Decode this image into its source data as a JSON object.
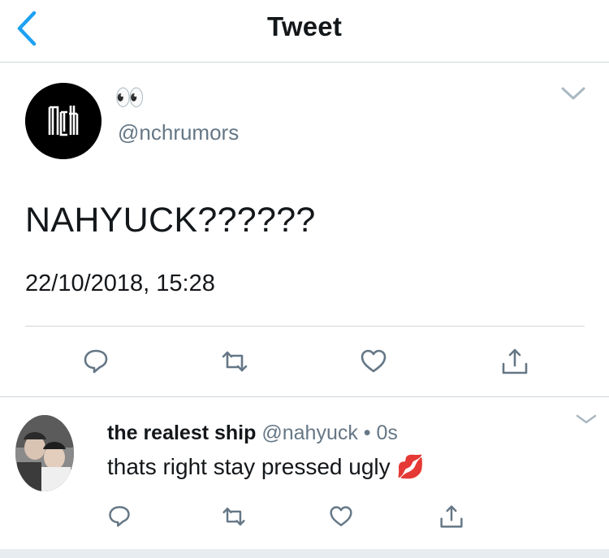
{
  "nav": {
    "title": "Tweet",
    "back_icon": "chevron-left-icon"
  },
  "main_tweet": {
    "display_name": "👀",
    "handle": "@nchrumors",
    "text": "NAHYUCK??????",
    "timestamp": "22/10/2018, 15:28",
    "avatar_logo_text": "nct",
    "actions": [
      "reply-icon",
      "retweet-icon",
      "like-icon",
      "share-icon"
    ]
  },
  "reply": {
    "display_name": "the realest ship",
    "handle": "@nahyuck",
    "separator": " • ",
    "time": "0s",
    "text": "thats right stay pressed ugly",
    "emoji": "💋",
    "actions": [
      "reply-icon",
      "retweet-icon",
      "like-icon",
      "share-icon"
    ]
  },
  "colors": {
    "accent": "#1da1f2",
    "secondary_text": "#657786",
    "icon": "#657786",
    "divider": "#cfd6dc"
  }
}
